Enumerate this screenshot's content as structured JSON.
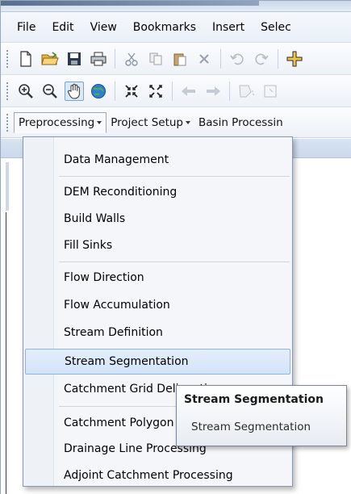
{
  "menubar": {
    "items": [
      "File",
      "Edit",
      "View",
      "Bookmarks",
      "Insert",
      "Selec"
    ]
  },
  "toolbar_standard": {
    "icons": [
      "new-document-icon",
      "open-folder-icon",
      "save-icon",
      "print-icon",
      "cut-icon",
      "copy-icon",
      "paste-icon",
      "delete-icon",
      "undo-icon",
      "redo-icon",
      "add-data-icon"
    ]
  },
  "toolbar_tools": {
    "icons": [
      "zoom-in-icon",
      "zoom-out-icon",
      "pan-icon",
      "full-extent-icon",
      "fixed-zoom-in-icon",
      "fixed-zoom-out-icon",
      "back-extent-icon",
      "forward-extent-icon",
      "select-features-icon",
      "clear-selection-icon"
    ]
  },
  "extension_toolbar": {
    "menus": [
      "Preprocessing",
      "Project Setup",
      "Basin Processin"
    ]
  },
  "dropdown": {
    "items": [
      "Data Management",
      "DEM Reconditioning",
      "Build Walls",
      "Fill Sinks",
      "Flow Direction",
      "Flow Accumulation",
      "Stream Definition",
      "Stream Segmentation",
      "Catchment Grid Delineation",
      "Catchment Polygon Processing",
      "Drainage Line Processing",
      "Adjoint Catchment Processing"
    ],
    "highlighted": "Stream Segmentation"
  },
  "tooltip": {
    "title": "Stream Segmentation",
    "description": "Stream Segmentation"
  },
  "colors": {
    "highlight": "#d3e4f9",
    "highlight_border": "#8fb3e2",
    "menu_bg": "#f4f6f9"
  }
}
